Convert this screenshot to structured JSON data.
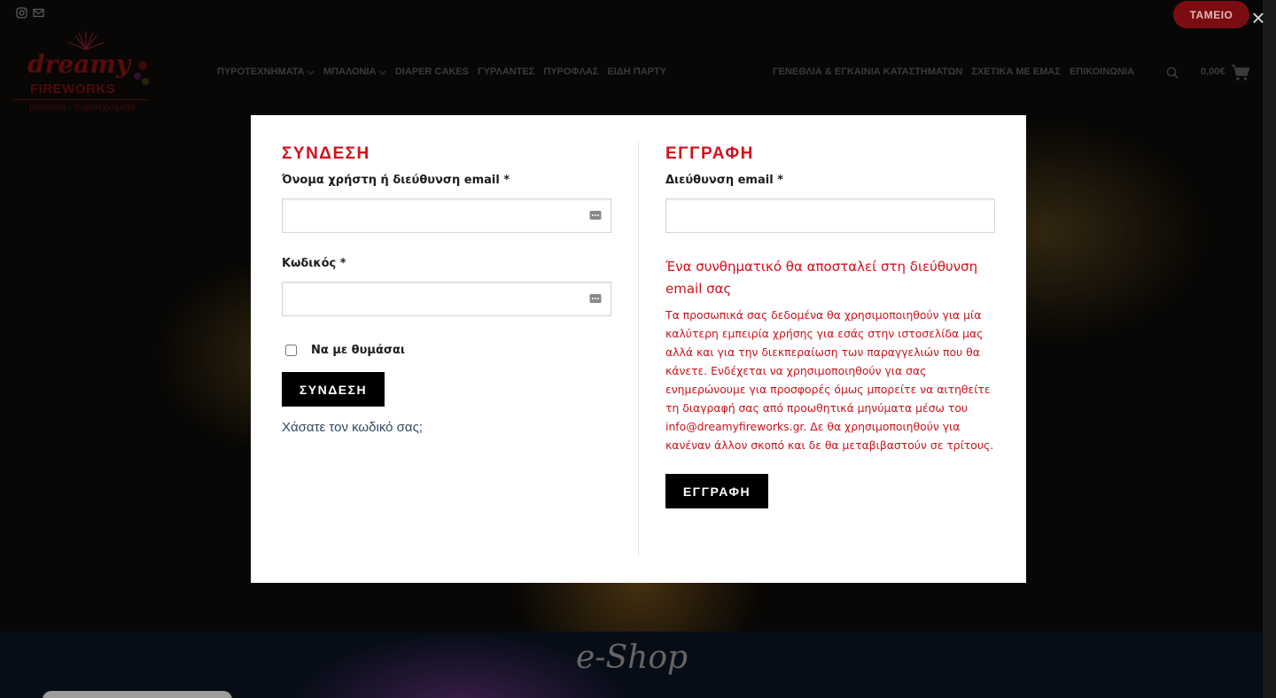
{
  "topbar": {
    "icons": [
      "instagram-icon",
      "mail-icon"
    ],
    "cart_button": "ΤΑΜΕΙΟ",
    "close_icon": "close-icon"
  },
  "logo": {
    "word": "dreamy",
    "fireworks": "FIREWORKS",
    "tagline": "μπαλόνια - πυροτεχνήματα"
  },
  "nav": {
    "left": [
      "ΠΥΡΟΤΕΧΝΗΜΑΤΑ ⌵",
      "ΜΠΑΛΟΝΙΑ ⌵",
      "DIAPER CAKES",
      "ΓΥΡΛΑΝΤΕΣ",
      "ΠΥΡΟΦΛΑΣ",
      "ΕΙΔΗ ΠΑΡΤΥ"
    ],
    "right": [
      "ΓΕΝΕΘΛΙΑ & ΕΓΚΑΙΝΙΑ ΚΑΤΑΣΤΗΜΑΤΩΝ",
      "ΣΧΕΤΙΚΑ ΜΕ ΕΜΑΣ",
      "ΕΠΙΚΟΙΝΩΝΙΑ"
    ],
    "cart_total": "0,00€"
  },
  "modal": {
    "login": {
      "title": "ΣΥΝΔΕΣΗ",
      "username_label": "Όνομα χρήστη ή διεύθυνση email",
      "password_label": "Κωδικός",
      "required_mark": "*",
      "username_value": "",
      "password_value": "",
      "remember_label": "Να με θυμάσαι",
      "remember_checked": false,
      "submit": "ΣΥΝΔΕΣΗ",
      "lost_password": "Χάσατε τον κωδικό σας;"
    },
    "register": {
      "title": "ΕΓΓΡΑΦΗ",
      "email_label": "Διεύθυνση email",
      "required_mark": "*",
      "email_value": "",
      "note": "Ένα συνθηματικό θα αποσταλεί στη διεύθυνση email σας",
      "privacy": "Τα προσωπικά σας δεδομένα θα χρησιμοποιηθούν για μία καλύτερη εμπειρία χρήσης για εσάς στην ιστοσελίδα μας αλλά και για την διεκπεραίωση των παραγγελιών που θα κάνετε. Ενδέχεται να χρησιμοποιηθούν για σας ενημερώνουμε για προσφορές όμως μπορείτε να αιτηθείτε τη διαγραφή σας από προωθητικά μηνύματα μέσω του info@dreamyfireworks.gr. Δε θα χρησιμοποιηθούν για κανέναν άλλον σκοπό και δε θα μεταβιβαστούν σε τρίτους.",
      "submit": "ΕΓΓΡΑΦΗ"
    }
  },
  "footer_banner": {
    "title": "e-Shop"
  },
  "colors": {
    "accent_red": "#d2101c",
    "button_black": "#000000",
    "link_blue": "#334862",
    "cart_red": "#7a0c12"
  }
}
